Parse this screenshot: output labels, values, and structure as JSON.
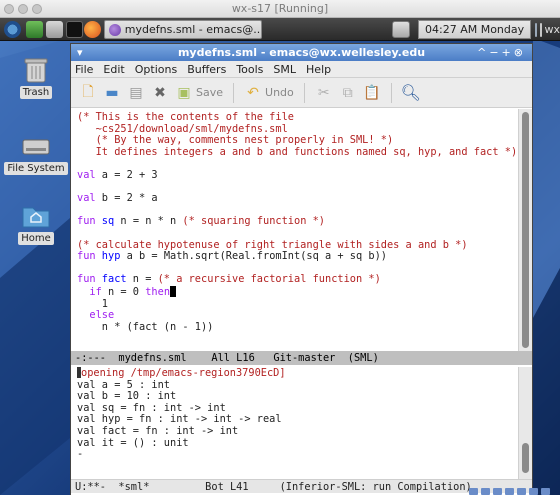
{
  "host": {
    "title": "wx-s17 [Running]"
  },
  "panel": {
    "task_label": "mydefns.sml - emacs@...",
    "clock": "04:27 AM Monday",
    "tray_text": "wx",
    "icons": [
      "fedora-icon",
      "image-viewer-icon",
      "files-icon",
      "terminal-icon",
      "firefox-icon",
      "emacs-icon",
      "network-icon",
      "volume-icon"
    ]
  },
  "desktop": {
    "icons": [
      {
        "label": "Trash",
        "icon": "trash-icon"
      },
      {
        "label": "File System",
        "icon": "drive-icon"
      },
      {
        "label": "Home",
        "icon": "home-folder-icon"
      }
    ]
  },
  "emacs": {
    "title": "mydefns.sml - emacs@wx.wellesley.edu",
    "menu": [
      "File",
      "Edit",
      "Options",
      "Buffers",
      "Tools",
      "SML",
      "Help"
    ],
    "toolbar": {
      "save": "Save",
      "undo": "Undo"
    },
    "code": {
      "l1": "(* This is the contents of the file",
      "l2": "   ~cs251/download/sml/mydefns.sml",
      "l3": "   (* By the way, comments nest properly in SML! *)",
      "l4": "   It defines integers a and b and functions named sq, hyp, and fact *)",
      "l6_kw": "val",
      "l6_rest": " a = 2 + 3",
      "l8_kw": "val",
      "l8_rest": " b = 2 * a",
      "l10_kw": "fun",
      "l10_name": " sq",
      "l10_rest": " n = n * n ",
      "l10_comment": "(* squaring function *)",
      "l12": "(* calculate hypotenuse of right triangle with sides a and b *)",
      "l13_kw": "fun",
      "l13_name": " hyp",
      "l13_rest": " a b = Math.sqrt(Real.fromInt(sq a + sq b))",
      "l15_kw": "fun",
      "l15_name": " fact",
      "l15_rest": " n = ",
      "l15_comment": "(* a recursive factorial function *)",
      "l16_kw1": "  if",
      "l16_rest": " n = 0 ",
      "l16_kw2": "then",
      "l17": "    1",
      "l18_kw": "  else",
      "l19": "    n * (fact (n - 1))"
    },
    "modeline_top": "-:---  mydefns.sml    All L16   Git-master  (SML)",
    "repl": {
      "l1": "opening /tmp/emacs-region3790EcD]",
      "l2": "val a = 5 : int",
      "l3": "val b = 10 : int",
      "l4": "val sq = fn : int -> int",
      "l5": "val hyp = fn : int -> int -> real",
      "l6": "val fact = fn : int -> int",
      "l7": "val it = () : unit",
      "l8": "-"
    },
    "modeline_bottom": "U:**-  *sml*         Bot L41     (Inferior-SML: run Compilation)"
  }
}
